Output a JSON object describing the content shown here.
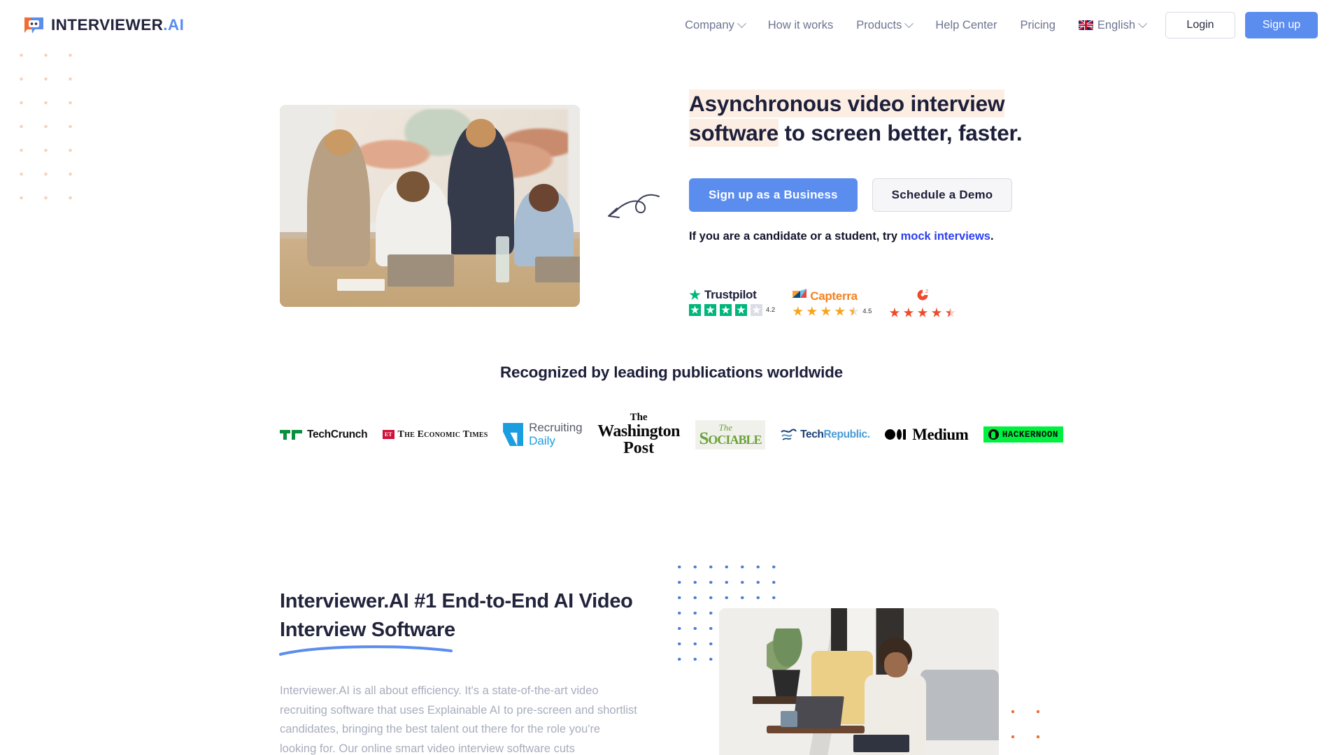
{
  "header": {
    "logo": {
      "name": "INTERVIEWER",
      "suffix": ".AI",
      "icon": "chat-robot-logo-icon"
    },
    "nav": [
      {
        "label": "Company",
        "has_dropdown": true
      },
      {
        "label": "How it works",
        "has_dropdown": false
      },
      {
        "label": "Products",
        "has_dropdown": true
      },
      {
        "label": "Help Center",
        "has_dropdown": false
      },
      {
        "label": "Pricing",
        "has_dropdown": false
      }
    ],
    "language": {
      "label": "English",
      "flag": "uk-flag-icon",
      "has_dropdown": true
    },
    "login_label": "Login",
    "signup_label": "Sign up",
    "accent_color": "#5b8def"
  },
  "hero": {
    "headline_highlight": "Asynchronous video interview software",
    "headline_rest": " to screen better, faster.",
    "highlight_color": "#fdeee4",
    "primary_cta": "Sign up as a Business",
    "secondary_cta": "Schedule a Demo",
    "candidate_text_before": "If you are a candidate or a student, try ",
    "candidate_link": "mock interviews",
    "candidate_text_after": ".",
    "link_color": "#2b3df0",
    "image_alt": "Four colleagues smiling around a laptop at a wooden table",
    "arrow_doodle": "curly-arrow-left-icon"
  },
  "ratings": [
    {
      "platform": "Trustpilot",
      "score": "4.2",
      "stars": 4.2,
      "color": "#00b67a"
    },
    {
      "platform": "Capterra",
      "score": "4.5",
      "stars": 4.5,
      "color": "#f8a41b"
    },
    {
      "platform": "G2",
      "score": "",
      "stars": 4.5,
      "color": "#ef4a2b"
    }
  ],
  "publications": {
    "title": "Recognized by leading publications worldwide",
    "logos": [
      {
        "name": "TechCrunch",
        "icon": "techcrunch-logo-icon"
      },
      {
        "name": "The Economic Times",
        "badge": "ET",
        "icon": "economic-times-logo-icon"
      },
      {
        "name": "Recruiting Daily",
        "line1": "Recruiting",
        "line2": "Daily",
        "icon": "recruiting-daily-logo-icon"
      },
      {
        "name": "The Washington Post",
        "line1": "The",
        "line2": "Washington",
        "line3": "Post",
        "icon": "washington-post-logo-icon"
      },
      {
        "name": "The Sociable",
        "line1": "The",
        "line2": "Sociable",
        "icon": "sociable-logo-icon"
      },
      {
        "name": "TechRepublic",
        "part1": "Tech",
        "part2": "Republic.",
        "icon": "techrepublic-logo-icon"
      },
      {
        "name": "Medium",
        "icon": "medium-logo-icon"
      },
      {
        "name": "HACKERNOON",
        "icon": "hackernoon-logo-icon"
      }
    ]
  },
  "feature": {
    "heading": "Interviewer.AI #1 End-to-End AI Video Interview Software",
    "underline_color": "#5b8def",
    "body": "Interviewer.AI is all about efficiency. It's a state-of-the-art video recruiting software that uses Explainable AI to pre-screen and shortlist candidates, bringing the best talent out there for the role you're looking for. Our online smart video interview software cuts",
    "image_alt": "Woman taking notes while watching a laptop in a living room"
  },
  "decor": {
    "peach_dot_color": "#f9cfbb",
    "blue_dot_color": "#4f7fd4",
    "orange_dot_color": "#e8713a"
  }
}
